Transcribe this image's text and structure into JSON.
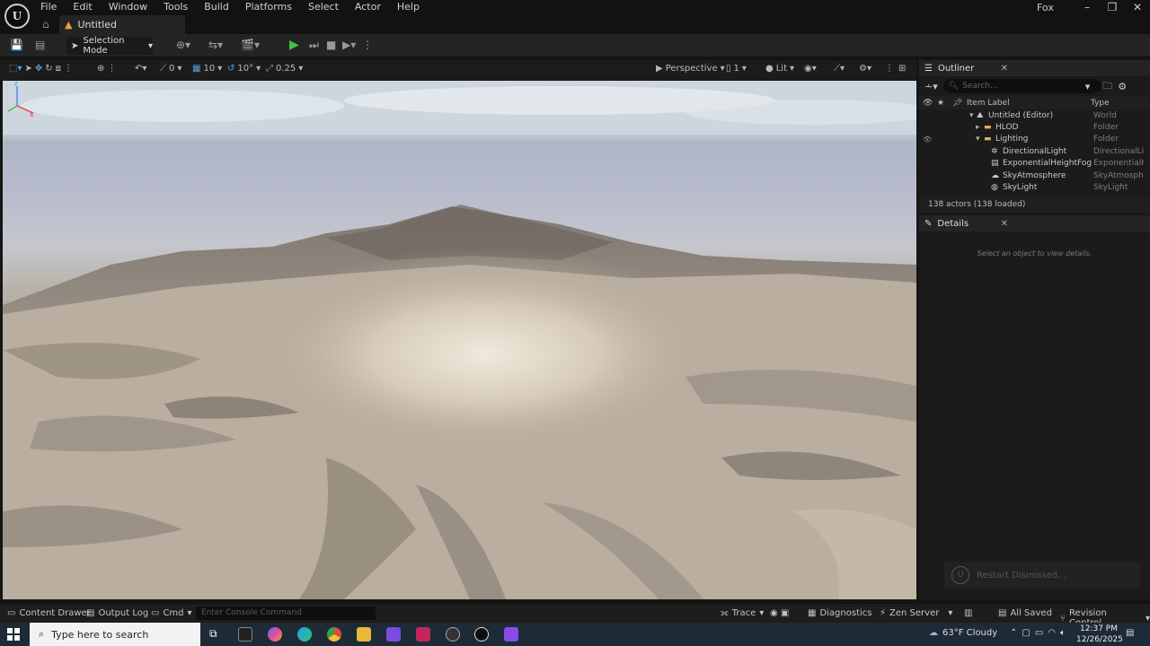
{
  "menu": [
    "File",
    "Edit",
    "Window",
    "Tools",
    "Build",
    "Platforms",
    "Select",
    "Actor",
    "Help"
  ],
  "document_tab": "Untitled",
  "user": "Fox",
  "toolbar": {
    "mode": "Selection Mode"
  },
  "viewport_toolbar": {
    "rotation_snap": "0",
    "grid_snap": "10",
    "angle_snap": "10°",
    "scale_snap": "0.25",
    "view_mode": "Perspective",
    "camera_count": "1",
    "lighting": "Lit"
  },
  "outliner": {
    "title": "Outliner",
    "search_placeholder": "Search...",
    "col_label": "Item Label",
    "col_type": "Type",
    "rows": [
      {
        "label": "Untitled (Editor)",
        "type": "World"
      },
      {
        "label": "HLOD",
        "type": "Folder"
      },
      {
        "label": "Lighting",
        "type": "Folder"
      },
      {
        "label": "DirectionalLight",
        "type": "DirectionalLig"
      },
      {
        "label": "ExponentialHeightFog",
        "type": "ExponentialHe"
      },
      {
        "label": "SkyAtmosphere",
        "type": "SkyAtmosphe"
      },
      {
        "label": "SkyLight",
        "type": "SkyLight"
      }
    ],
    "actor_count": "138 actors (138 loaded)"
  },
  "details": {
    "title": "Details",
    "empty_text": "Select an object to view details.",
    "toast": "Restart Dismissed..."
  },
  "statusbar": {
    "content_drawer": "Content Drawer",
    "output_log": "Output Log",
    "cmd": "Cmd",
    "console_placeholder": "Enter Console Command",
    "trace": "Trace",
    "diagnostics": "Diagnostics",
    "zen_server": "Zen Server",
    "all_saved": "All Saved",
    "revision_control": "Revision Control"
  },
  "taskbar": {
    "search_placeholder": "Type here to search",
    "weather": "63°F  Cloudy",
    "time": "12:37 PM",
    "date": "12/26/2025"
  },
  "colors": {
    "accent": "#5aa0e8",
    "play": "#3ec43e"
  }
}
